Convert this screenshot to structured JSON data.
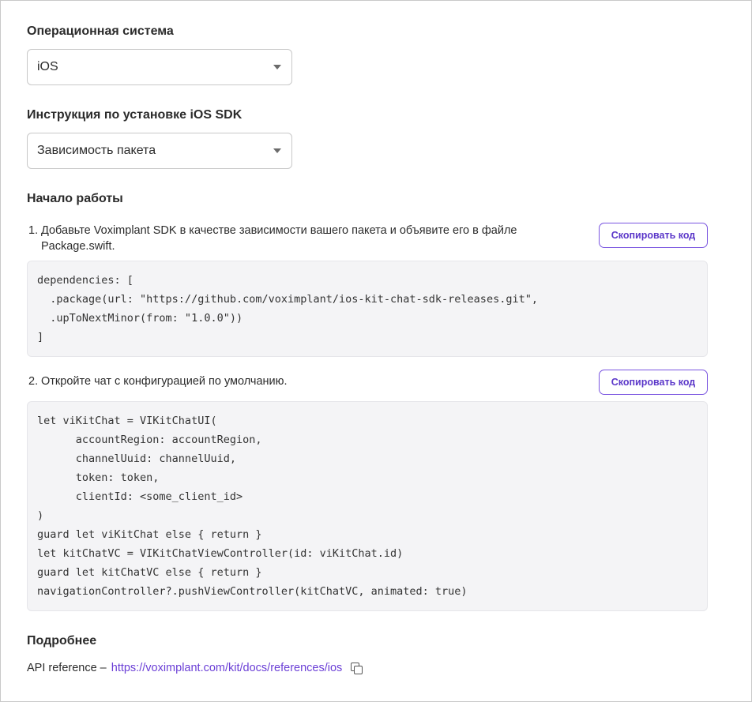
{
  "os_section": {
    "label": "Операционная система",
    "selected": "iOS"
  },
  "install_section": {
    "label": "Инструкция по установке iOS SDK",
    "selected": "Зависимость пакета"
  },
  "start_section": {
    "label": "Начало работы"
  },
  "step1": {
    "number": "1.",
    "text_line1": "Добавьте Voximplant SDK в качестве зависимости вашего пакета и объявите его в файле",
    "text_line2": "Package.swift.",
    "copy_label": "Скопировать код",
    "code": [
      "dependencies: [",
      "  .package(url: \"https://github.com/voximplant/ios-kit-chat-sdk-releases.git\",",
      "  .upToNextMinor(from: \"1.0.0\"))",
      "]"
    ]
  },
  "step2": {
    "number": "2.",
    "text": "Откройте чат с конфигурацией по умолчанию.",
    "copy_label": "Скопировать код",
    "code": [
      "let viKitChat = VIKitChatUI(",
      "      accountRegion: accountRegion,",
      "      channelUuid: channelUuid,",
      "      token: token,",
      "      clientId: <some_client_id>",
      ")",
      "guard let viKitChat else { return }",
      "let kitChatVC = VIKitChatViewController(id: viKitChat.id)",
      "guard let kitChatVC else { return }",
      "navigationController?.pushViewController(kitChatVC, animated: true)"
    ]
  },
  "more_section": {
    "label": "Подробнее",
    "api_prefix": "API reference –",
    "api_link": "https://voximplant.com/kit/docs/references/ios",
    "copy_icon": "copy-icon"
  },
  "colors": {
    "accent": "#6b3fd6",
    "code_bg": "#f4f4f6"
  }
}
